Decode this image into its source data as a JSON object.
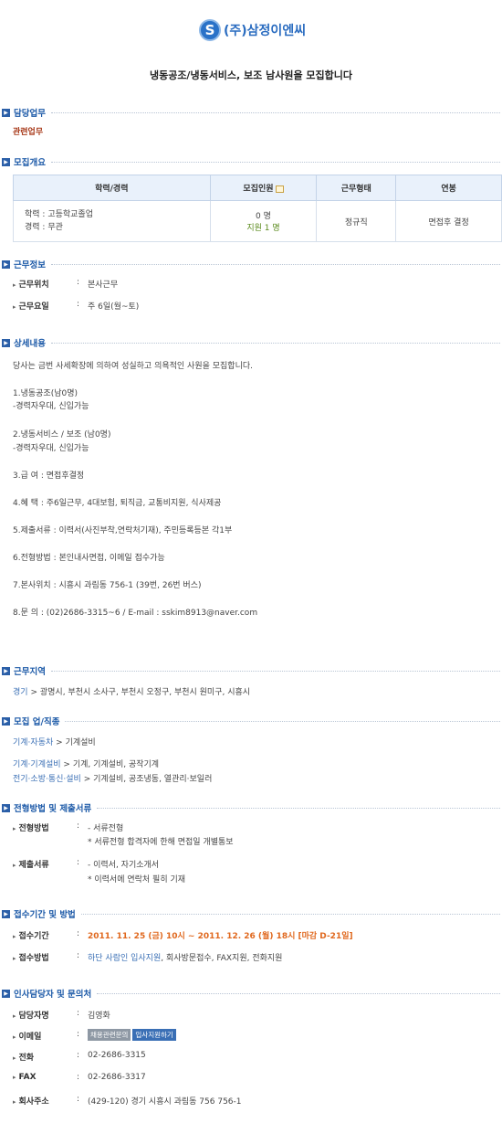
{
  "logo": {
    "mark": "S",
    "name": "(주)삼정이엔씨"
  },
  "headline": "냉동공조/냉동서비스, 보조 남사원을 모집합니다",
  "sections": {
    "duty": "담당업무",
    "summary": "모집개요",
    "condition": "근무정보",
    "detail": "상세내용",
    "region": "근무지역",
    "job": "모집 업/직종",
    "process": "전형방법 및 제출서류",
    "apply": "접수기간 및 방법",
    "contact": "인사담당자 및 문의처"
  },
  "duty_text": "관련업무",
  "table": {
    "headers": [
      "학력/경력",
      "모집인원",
      "근무형태",
      "연봉"
    ],
    "edu": "학력 : 고등학교졸업",
    "career": "경력 : 무관",
    "count": "0 명",
    "applicants": "지원 1 명",
    "type": "정규직",
    "salary": "면접후 결정"
  },
  "condition": {
    "location_label": "근무위치",
    "location_value": "본사근무",
    "days_label": "근무요일",
    "days_value": "주 6일(월~토)"
  },
  "detail_lines": [
    "당사는 금번 사세확장에 의하여 성실하고 의욕적인 사원을 모집합니다.",
    "1.냉동공조(남0명)",
    "-경력자우대, 신입가능",
    "2.냉동서비스 / 보조 (남0명)",
    "-경력자우대, 신입가능",
    "3.급 여 : 면접후결정",
    "4.혜 택 : 주6일근무, 4대보험, 퇴직금, 교통비지원, 식사제공",
    "5.제출서류 : 이력서(사진부착,연락처기재), 주민등록등본 각1부",
    "6.전형방법 : 본인내사면접, 이메일 접수가능",
    "7.본사위치 : 시흥시 과림동 756-1 (39번, 26번 버스)",
    "8.문 의 : (02)2686-3315~6 / E-mail : sskim8913@naver.com"
  ],
  "region": {
    "head": "경기",
    "sep": ">",
    "list": "광명시, 부천시 소사구, 부천시 오정구, 부천시 원미구, 시흥시"
  },
  "job": {
    "row1_cat": "기계·자동차",
    "row1_sep": ">",
    "row1_val": "기계설비",
    "row2_cat": "기계·기계설비",
    "row2_sep": ">",
    "row2_val": "기계, 기계설비, 공작기계",
    "row3_cat": "전기·소방·통신·설비",
    "row3_sep": ">",
    "row3_val": "기계설비, 공조냉동, 열관리·보일러"
  },
  "process": {
    "method_label": "전형방법",
    "colon": ":",
    "method_1": "- 서류전형",
    "method_2": "* 서류전형 합격자에 한해 면접일 개별통보",
    "docs_label": "제출서류",
    "docs_1": "- 이력서, 자기소개서",
    "docs_2": "* 이력서에 연락처 필히 기재"
  },
  "apply": {
    "period_label": "접수기간",
    "period_value": "2011. 11. 25 (금) 10시 ~ 2011. 12. 26 (월) 18시 [마감 D-21일]",
    "method_label": "접수방법",
    "method_link": "하단 사람인 입사지원",
    "method_rest": ", 회사방문접수, FAX지원, 전화지원"
  },
  "contact": {
    "name_label": "담당자명",
    "name_value": "김영화",
    "email_label": "이메일",
    "email_btn1": "채용관련문의",
    "email_btn2": "입사지원하기",
    "tel_label": "전화",
    "tel_value": "02-2686-3315",
    "fax_label": "FAX",
    "fax_value": "02-2686-3317",
    "addr_label": "회사주소",
    "addr_value": "(429-120) 경기 시흥시 과림동 756 756-1"
  }
}
